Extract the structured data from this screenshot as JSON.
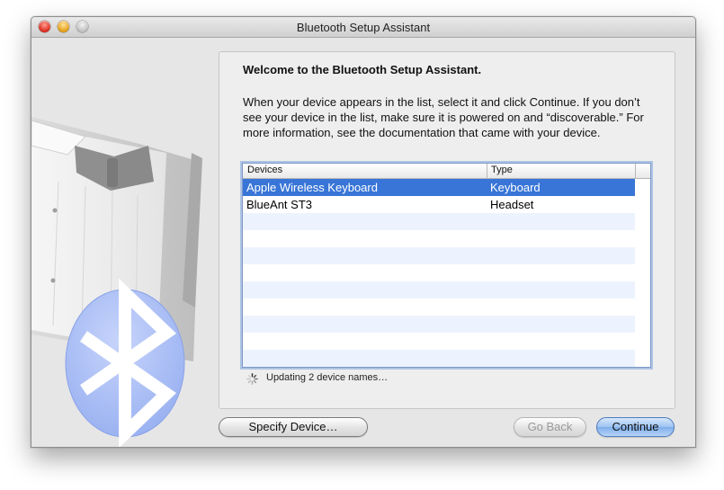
{
  "window": {
    "title": "Bluetooth Setup Assistant",
    "controls": [
      "close",
      "minimize",
      "zoom"
    ]
  },
  "content": {
    "welcome": "Welcome to the Bluetooth Setup Assistant.",
    "instructions": "When your device appears in the list, select it and click Continue. If you don’t see your device in the list, make sure it is powered on and “discoverable.” For more information, see the documentation that came with your device."
  },
  "device_table": {
    "columns": [
      "Devices",
      "Type"
    ],
    "rows": [
      {
        "device": "Apple Wireless Keyboard",
        "type": "Keyboard",
        "selected": true
      },
      {
        "device": "BlueAnt ST3",
        "type": "Headset",
        "selected": false
      }
    ]
  },
  "status": {
    "text": "Updating 2 device names…",
    "icon": "spinner-icon"
  },
  "buttons": {
    "specify_device": "Specify Device…",
    "go_back": "Go Back",
    "continue": "Continue"
  },
  "illustration": {
    "icon": "bluetooth-butler-icon"
  },
  "colors": {
    "selection": "#3875d7",
    "stripe": "#edf3fe",
    "bluetooth_badge": "#a9bdf5"
  }
}
